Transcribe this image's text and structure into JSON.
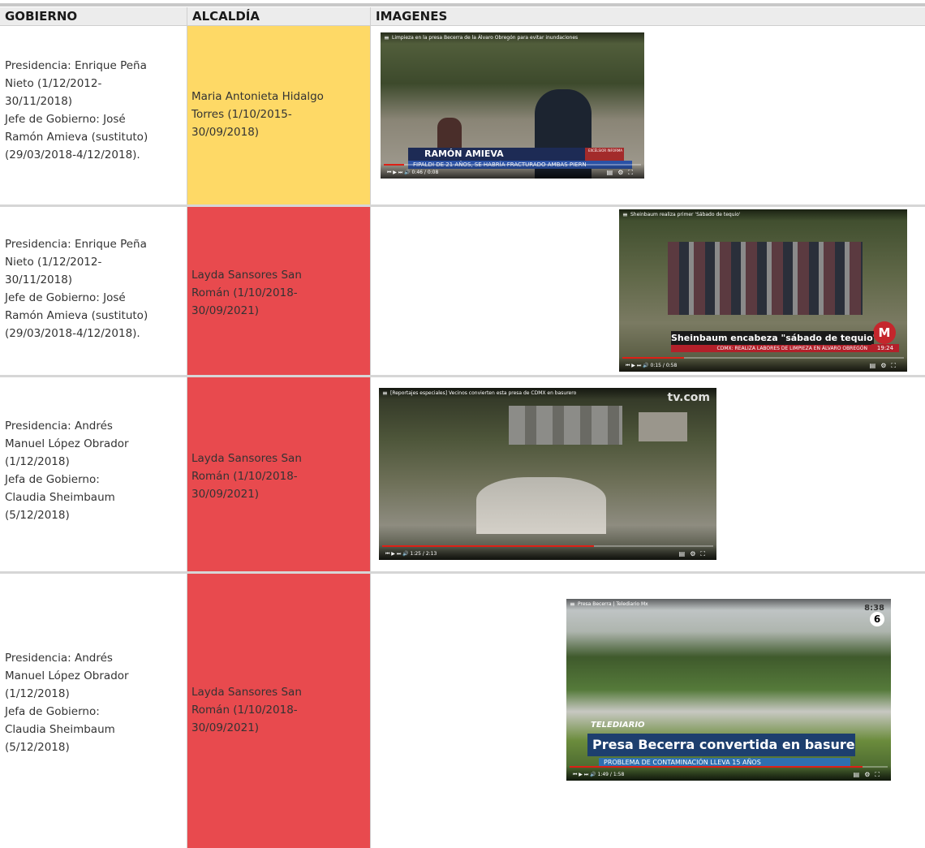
{
  "headers": {
    "gobierno": "GOBIERNO",
    "alcaldia": "ALCALDÍA",
    "imagenes": "IMAGENES"
  },
  "colors": {
    "yellow": "#fed966",
    "red": "#e84a4e"
  },
  "rows": [
    {
      "gobierno": [
        "Presidencia: Enrique Peña",
        "Nieto (1/12/2012-",
        "30/11/2018)",
        "Jefe de Gobierno: José",
        "Ramón Amieva (sustituto)",
        "(29/03/2018-4/12/2018)."
      ],
      "alcaldia": [
        "Maria Antonieta Hidalgo",
        "Torres (1/10/2015-",
        "30/09/2018)"
      ],
      "alcaldia_color": "yellow",
      "video": {
        "title": "Limpieza en la presa Becerra de la Álvaro Obregón para evitar inundaciones",
        "time": "0:46 / 0:08",
        "progress": 0.08,
        "lower_third": "RAMÓN AMIEVA",
        "ticker": "FIPALDI DE 21 AÑOS, SE HABRÍA FRACTURADO AMBAS PIERN",
        "network": "EXCÉLSIOR INFORMA"
      }
    },
    {
      "gobierno": [
        "Presidencia: Enrique Peña",
        "Nieto (1/12/2012-",
        "30/11/2018)",
        "Jefe de Gobierno: José",
        "Ramón Amieva (sustituto)",
        "(29/03/2018-4/12/2018)."
      ],
      "alcaldia": [
        "Layda Sansores San",
        "Román (1/10/2018-",
        "30/09/2021)"
      ],
      "alcaldia_color": "red",
      "video": {
        "title": "Sheinbaum realiza primer 'Sábado de tequio'",
        "time": "0:15 / 0:58",
        "progress": 0.22,
        "lower_third": "Sheinbaum encabeza \"sábado de tequio\"",
        "ticker": "CDMX: REALIZA LABORES DE LIMPIEZA EN ÁLVARO OBREGÓN",
        "clock": "19:24"
      }
    },
    {
      "gobierno": [
        "Presidencia: Andrés",
        "Manuel López Obrador",
        "(1/12/2018)",
        "Jefa de Gobierno:",
        "Claudia Sheimbaum",
        "(5/12/2018)"
      ],
      "alcaldia": [
        "Layda Sansores San",
        "Román (1/10/2018-",
        "30/09/2021)"
      ],
      "alcaldia_color": "red",
      "video": {
        "title": "[Reportajes especiales] Vecinos convierten esta presa de CDMX en basurero",
        "time": "1:25 / 2:13",
        "progress": 0.64,
        "watermark": "tv.com"
      }
    },
    {
      "gobierno": [
        "Presidencia: Andrés",
        "Manuel López Obrador",
        "(1/12/2018)",
        "Jefa de Gobierno:",
        "Claudia Sheimbaum",
        "(5/12/2018)"
      ],
      "alcaldia": [
        "Layda Sansores San",
        "Román (1/10/2018-",
        "30/09/2021)"
      ],
      "alcaldia_color": "red",
      "video": {
        "title": "Presa Becerra | Telediario Mx",
        "time": "1:49 / 1:58",
        "progress": 0.92,
        "lower_third": "Presa Becerra convertida en basurero",
        "ticker": "PROBLEMA DE CONTAMINACIÓN LLEVA 15 AÑOS",
        "brand": "TELEDIARIO",
        "clock": "8:38"
      }
    }
  ]
}
